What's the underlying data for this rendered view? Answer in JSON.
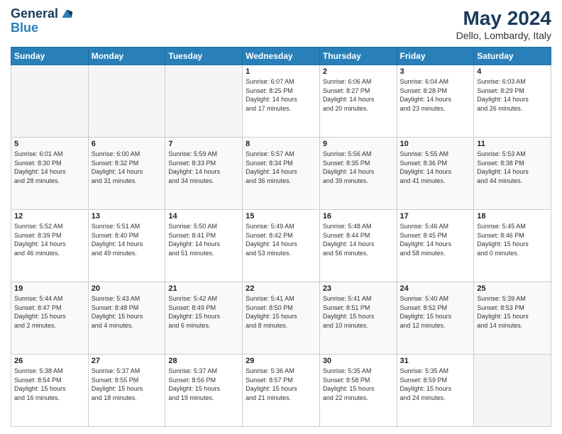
{
  "logo": {
    "line1": "General",
    "line2": "Blue"
  },
  "header": {
    "month_year": "May 2024",
    "location": "Dello, Lombardy, Italy"
  },
  "days_of_week": [
    "Sunday",
    "Monday",
    "Tuesday",
    "Wednesday",
    "Thursday",
    "Friday",
    "Saturday"
  ],
  "weeks": [
    [
      {
        "num": "",
        "info": ""
      },
      {
        "num": "",
        "info": ""
      },
      {
        "num": "",
        "info": ""
      },
      {
        "num": "1",
        "info": "Sunrise: 6:07 AM\nSunset: 8:25 PM\nDaylight: 14 hours\nand 17 minutes."
      },
      {
        "num": "2",
        "info": "Sunrise: 6:06 AM\nSunset: 8:27 PM\nDaylight: 14 hours\nand 20 minutes."
      },
      {
        "num": "3",
        "info": "Sunrise: 6:04 AM\nSunset: 8:28 PM\nDaylight: 14 hours\nand 23 minutes."
      },
      {
        "num": "4",
        "info": "Sunrise: 6:03 AM\nSunset: 8:29 PM\nDaylight: 14 hours\nand 26 minutes."
      }
    ],
    [
      {
        "num": "5",
        "info": "Sunrise: 6:01 AM\nSunset: 8:30 PM\nDaylight: 14 hours\nand 28 minutes."
      },
      {
        "num": "6",
        "info": "Sunrise: 6:00 AM\nSunset: 8:32 PM\nDaylight: 14 hours\nand 31 minutes."
      },
      {
        "num": "7",
        "info": "Sunrise: 5:59 AM\nSunset: 8:33 PM\nDaylight: 14 hours\nand 34 minutes."
      },
      {
        "num": "8",
        "info": "Sunrise: 5:57 AM\nSunset: 8:34 PM\nDaylight: 14 hours\nand 36 minutes."
      },
      {
        "num": "9",
        "info": "Sunrise: 5:56 AM\nSunset: 8:35 PM\nDaylight: 14 hours\nand 39 minutes."
      },
      {
        "num": "10",
        "info": "Sunrise: 5:55 AM\nSunset: 8:36 PM\nDaylight: 14 hours\nand 41 minutes."
      },
      {
        "num": "11",
        "info": "Sunrise: 5:53 AM\nSunset: 8:38 PM\nDaylight: 14 hours\nand 44 minutes."
      }
    ],
    [
      {
        "num": "12",
        "info": "Sunrise: 5:52 AM\nSunset: 8:39 PM\nDaylight: 14 hours\nand 46 minutes."
      },
      {
        "num": "13",
        "info": "Sunrise: 5:51 AM\nSunset: 8:40 PM\nDaylight: 14 hours\nand 49 minutes."
      },
      {
        "num": "14",
        "info": "Sunrise: 5:50 AM\nSunset: 8:41 PM\nDaylight: 14 hours\nand 51 minutes."
      },
      {
        "num": "15",
        "info": "Sunrise: 5:49 AM\nSunset: 8:42 PM\nDaylight: 14 hours\nand 53 minutes."
      },
      {
        "num": "16",
        "info": "Sunrise: 5:48 AM\nSunset: 8:44 PM\nDaylight: 14 hours\nand 56 minutes."
      },
      {
        "num": "17",
        "info": "Sunrise: 5:46 AM\nSunset: 8:45 PM\nDaylight: 14 hours\nand 58 minutes."
      },
      {
        "num": "18",
        "info": "Sunrise: 5:45 AM\nSunset: 8:46 PM\nDaylight: 15 hours\nand 0 minutes."
      }
    ],
    [
      {
        "num": "19",
        "info": "Sunrise: 5:44 AM\nSunset: 8:47 PM\nDaylight: 15 hours\nand 2 minutes."
      },
      {
        "num": "20",
        "info": "Sunrise: 5:43 AM\nSunset: 8:48 PM\nDaylight: 15 hours\nand 4 minutes."
      },
      {
        "num": "21",
        "info": "Sunrise: 5:42 AM\nSunset: 8:49 PM\nDaylight: 15 hours\nand 6 minutes."
      },
      {
        "num": "22",
        "info": "Sunrise: 5:41 AM\nSunset: 8:50 PM\nDaylight: 15 hours\nand 8 minutes."
      },
      {
        "num": "23",
        "info": "Sunrise: 5:41 AM\nSunset: 8:51 PM\nDaylight: 15 hours\nand 10 minutes."
      },
      {
        "num": "24",
        "info": "Sunrise: 5:40 AM\nSunset: 8:52 PM\nDaylight: 15 hours\nand 12 minutes."
      },
      {
        "num": "25",
        "info": "Sunrise: 5:39 AM\nSunset: 8:53 PM\nDaylight: 15 hours\nand 14 minutes."
      }
    ],
    [
      {
        "num": "26",
        "info": "Sunrise: 5:38 AM\nSunset: 8:54 PM\nDaylight: 15 hours\nand 16 minutes."
      },
      {
        "num": "27",
        "info": "Sunrise: 5:37 AM\nSunset: 8:55 PM\nDaylight: 15 hours\nand 18 minutes."
      },
      {
        "num": "28",
        "info": "Sunrise: 5:37 AM\nSunset: 8:56 PM\nDaylight: 15 hours\nand 19 minutes."
      },
      {
        "num": "29",
        "info": "Sunrise: 5:36 AM\nSunset: 8:57 PM\nDaylight: 15 hours\nand 21 minutes."
      },
      {
        "num": "30",
        "info": "Sunrise: 5:35 AM\nSunset: 8:58 PM\nDaylight: 15 hours\nand 22 minutes."
      },
      {
        "num": "31",
        "info": "Sunrise: 5:35 AM\nSunset: 8:59 PM\nDaylight: 15 hours\nand 24 minutes."
      },
      {
        "num": "",
        "info": ""
      }
    ]
  ]
}
